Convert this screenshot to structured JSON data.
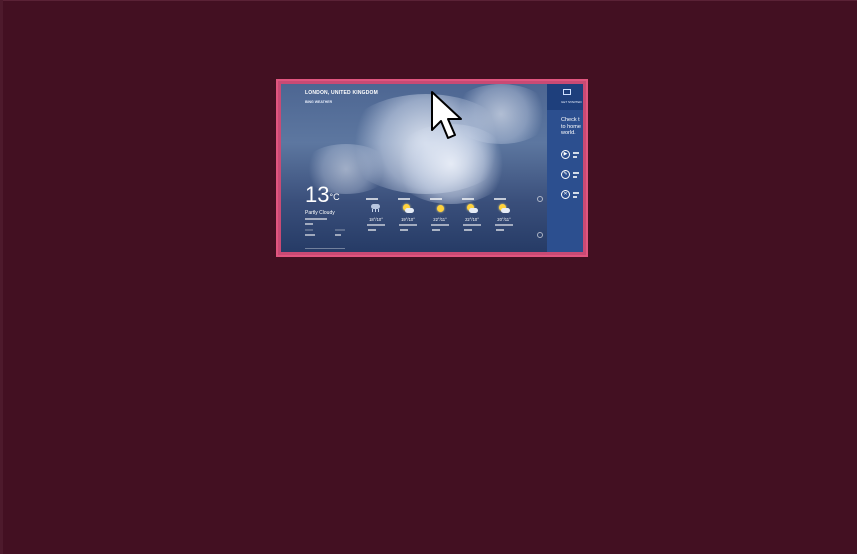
{
  "window": {
    "title": "Weather",
    "location": "LONDON, UNITED KINGDOM",
    "subtitle": "BING WEATHER"
  },
  "current": {
    "temperature": "13",
    "unit": "°C",
    "condition": "Partly Cloudy"
  },
  "forecast": [
    {
      "temp": "18°/10°",
      "icon": "rain-icon"
    },
    {
      "temp": "19°/10°",
      "icon": "partly-cloudy-icon"
    },
    {
      "temp": "22°/11°",
      "icon": "sunny-icon"
    },
    {
      "temp": "22°/10°",
      "icon": "partly-cloudy-icon"
    },
    {
      "temp": "20°/11°",
      "icon": "partly-cloudy-icon"
    }
  ],
  "side_panel": {
    "title": "GET STARTED",
    "text_lines": [
      "Check t",
      "to home",
      "world."
    ]
  },
  "colors": {
    "desktop": "#431022",
    "frame": "#e0557f",
    "panel": "#2c4f8f"
  }
}
